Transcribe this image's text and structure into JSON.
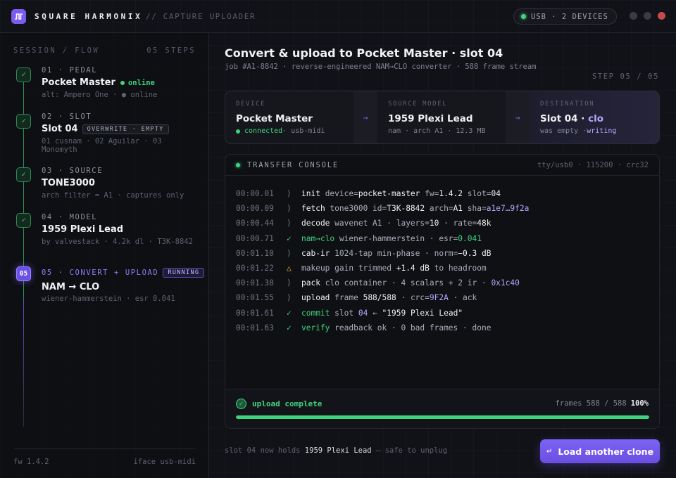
{
  "header": {
    "brand": "SQUARE HARMONIX",
    "subtitle": "// CAPTURE UPLOADER",
    "usb_status": "USB · 2 DEVICES",
    "logo_icon": "square-wave-icon"
  },
  "sidebar": {
    "heading": "SESSION / FLOW",
    "step_count": "05 STEPS",
    "steps": [
      {
        "kicker": "01 · PEDAL",
        "title": "Pocket Master",
        "status": "online",
        "sub": "alt: Ampero One · ● online",
        "badge": "✓"
      },
      {
        "kicker": "02 · SLOT",
        "title": "Slot 04",
        "tag": "OVERWRITE · EMPTY",
        "sub": "01 cusnam · 02 Aguilar · 03 Monomyth",
        "badge": "✓"
      },
      {
        "kicker": "03 · SOURCE",
        "title": "TONE3000",
        "sub": "arch filter = A1 · captures only",
        "badge": "✓"
      },
      {
        "kicker": "04 · MODEL",
        "title": "1959 Plexi Lead",
        "sub": "by valvestack · 4.2k dl · T3K-8842",
        "badge": "✓"
      },
      {
        "kicker": "05 · CONVERT + UPLOAD",
        "title": "NAM → CLO",
        "tag": "RUNNING",
        "sub": "wiener-hammerstein · esr 0.041",
        "badge": "05"
      }
    ],
    "footer": {
      "fw": "fw 1.4.2",
      "iface": "iface usb-midi"
    }
  },
  "main": {
    "title": "Convert & upload to Pocket Master · slot 04",
    "meta": "job #A1-8842  ·  reverse-engineered NAM→CLO converter  ·  588 frame stream",
    "step": "STEP 05 / 05",
    "pipeline": {
      "device": {
        "label": "DEVICE",
        "value": "Pocket Master",
        "detail_a": "connected",
        "detail_b": " · usb-midi"
      },
      "source": {
        "label": "SOURCE MODEL",
        "value": "1959 Plexi Lead",
        "detail": "nam · arch A1 · 12.3 MB"
      },
      "destination": {
        "label": "DESTINATION",
        "value_a": "Slot 04 · ",
        "value_b": "clo",
        "detail_a": "was empty · ",
        "detail_b": "writing"
      },
      "arrow": "→"
    },
    "console": {
      "title": "TRANSFER CONSOLE",
      "port": "tty/usb0 · 115200 · crc32",
      "complete_label": "upload complete",
      "frames": "frames 588 / 588",
      "percent": "100%",
      "progress": 1.0
    },
    "footer_note_a": "slot 04 now holds ",
    "footer_note_b": "1959 Plexi Lead",
    "footer_note_c": " — safe to unplug",
    "cta": "Load another clone"
  },
  "colors": {
    "accent": "#7b5cf0",
    "success": "#3fd37e",
    "warn": "#e0a33c",
    "background": "#111217"
  },
  "log": [
    {
      "ts": "00:00.01",
      "mk": ")",
      "kind": "",
      "cmd": "init",
      "parts": [
        [
          "",
          "  device="
        ],
        [
          "v",
          "pocket-master"
        ],
        [
          "",
          " fw="
        ],
        [
          "v",
          "1.4.2"
        ],
        [
          "",
          " slot="
        ],
        [
          "v",
          "04"
        ]
      ]
    },
    {
      "ts": "00:00.09",
      "mk": ")",
      "kind": "",
      "cmd": "fetch",
      "parts": [
        [
          "",
          " tone3000 id="
        ],
        [
          "v",
          "T3K-8842"
        ],
        [
          "",
          " arch="
        ],
        [
          "v",
          "A1"
        ],
        [
          "",
          " sha="
        ],
        [
          "pv",
          "a1e7…9f2a"
        ]
      ]
    },
    {
      "ts": "00:00.44",
      "mk": ")",
      "kind": "",
      "cmd": "decode",
      "parts": [
        [
          "",
          " wavenet A1 · layers="
        ],
        [
          "v",
          "10"
        ],
        [
          "",
          " · rate="
        ],
        [
          "v",
          "48k"
        ]
      ]
    },
    {
      "ts": "00:00.71",
      "mk": "✓",
      "kind": "ok",
      "cmd": "nam→clo",
      "cmdgreen": true,
      "parts": [
        [
          "",
          " wiener-hammerstein · esr="
        ],
        [
          "gv",
          "0.041"
        ]
      ]
    },
    {
      "ts": "00:01.10",
      "mk": ")",
      "kind": "",
      "cmd": "cab-ir",
      "parts": [
        [
          "",
          " 1024-tap min-phase · norm="
        ],
        [
          "v",
          "−0.3 dB"
        ]
      ]
    },
    {
      "ts": "00:01.22",
      "mk": "△",
      "kind": "warn",
      "cmd": "",
      "parts": [
        [
          "",
          "makeup gain trimmed "
        ],
        [
          "v",
          "+1.4 dB"
        ],
        [
          "",
          " to headroom"
        ]
      ]
    },
    {
      "ts": "00:01.38",
      "mk": ")",
      "kind": "",
      "cmd": "pack",
      "parts": [
        [
          "",
          " clo container · 4 scalars + 2 ir · "
        ],
        [
          "pv",
          "0x1c40"
        ]
      ]
    },
    {
      "ts": "00:01.55",
      "mk": ")",
      "kind": "",
      "cmd": "upload",
      "parts": [
        [
          "",
          " frame "
        ],
        [
          "v",
          "588/588"
        ],
        [
          "",
          " · crc="
        ],
        [
          "pv",
          "9F2A"
        ],
        [
          "",
          " · ack"
        ]
      ]
    },
    {
      "ts": "00:01.61",
      "mk": "✓",
      "kind": "ok",
      "cmd": "commit",
      "cmdgreen": true,
      "parts": [
        [
          "",
          " slot "
        ],
        [
          "pv",
          "04"
        ],
        [
          "",
          " ← "
        ],
        [
          "v",
          "\"1959 Plexi Lead\""
        ]
      ]
    },
    {
      "ts": "00:01.63",
      "mk": "✓",
      "kind": "ok",
      "cmd": "verify",
      "cmdgreen": true,
      "parts": [
        [
          "",
          " readback ok · 0 bad frames · done"
        ]
      ]
    }
  ]
}
